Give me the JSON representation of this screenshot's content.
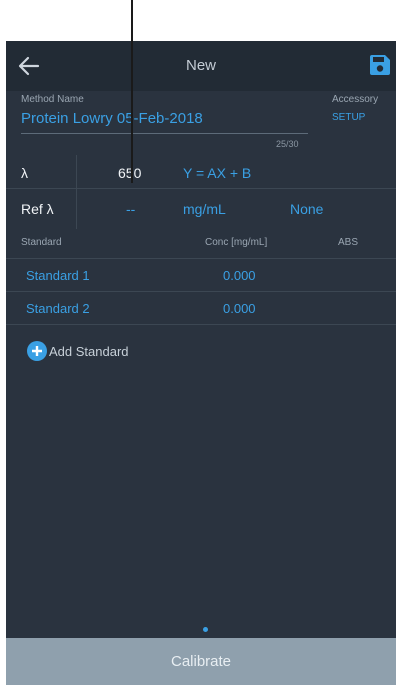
{
  "toolbar": {
    "title": "New"
  },
  "method": {
    "name_label": "Method Name",
    "name_value": "Protein Lowry 05-Feb-2018",
    "counter": "25/30"
  },
  "accessory": {
    "label": "Accessory",
    "setup": "SETUP"
  },
  "wavelength": {
    "label": "λ",
    "value": "650",
    "equation": "Y = AX + B"
  },
  "ref": {
    "label": "Ref λ",
    "value": "--",
    "unit": "mg/mL",
    "curve": "None"
  },
  "standards_table": {
    "headers": [
      "Standard",
      "Conc [mg/mL]",
      "ABS"
    ],
    "rows": [
      {
        "name": "Standard 1",
        "conc": "0.000"
      },
      {
        "name": "Standard 2",
        "conc": "0.000"
      }
    ]
  },
  "add_standard": "Add Standard",
  "calibrate": "Calibrate",
  "colors": {
    "accent": "#3aa0e4",
    "background": "#2a333f",
    "toolbar": "#222b35",
    "button": "#8fa0ad"
  },
  "icons": {
    "back": "arrow-left-icon",
    "save": "save-icon",
    "add": "plus-circle-icon"
  }
}
